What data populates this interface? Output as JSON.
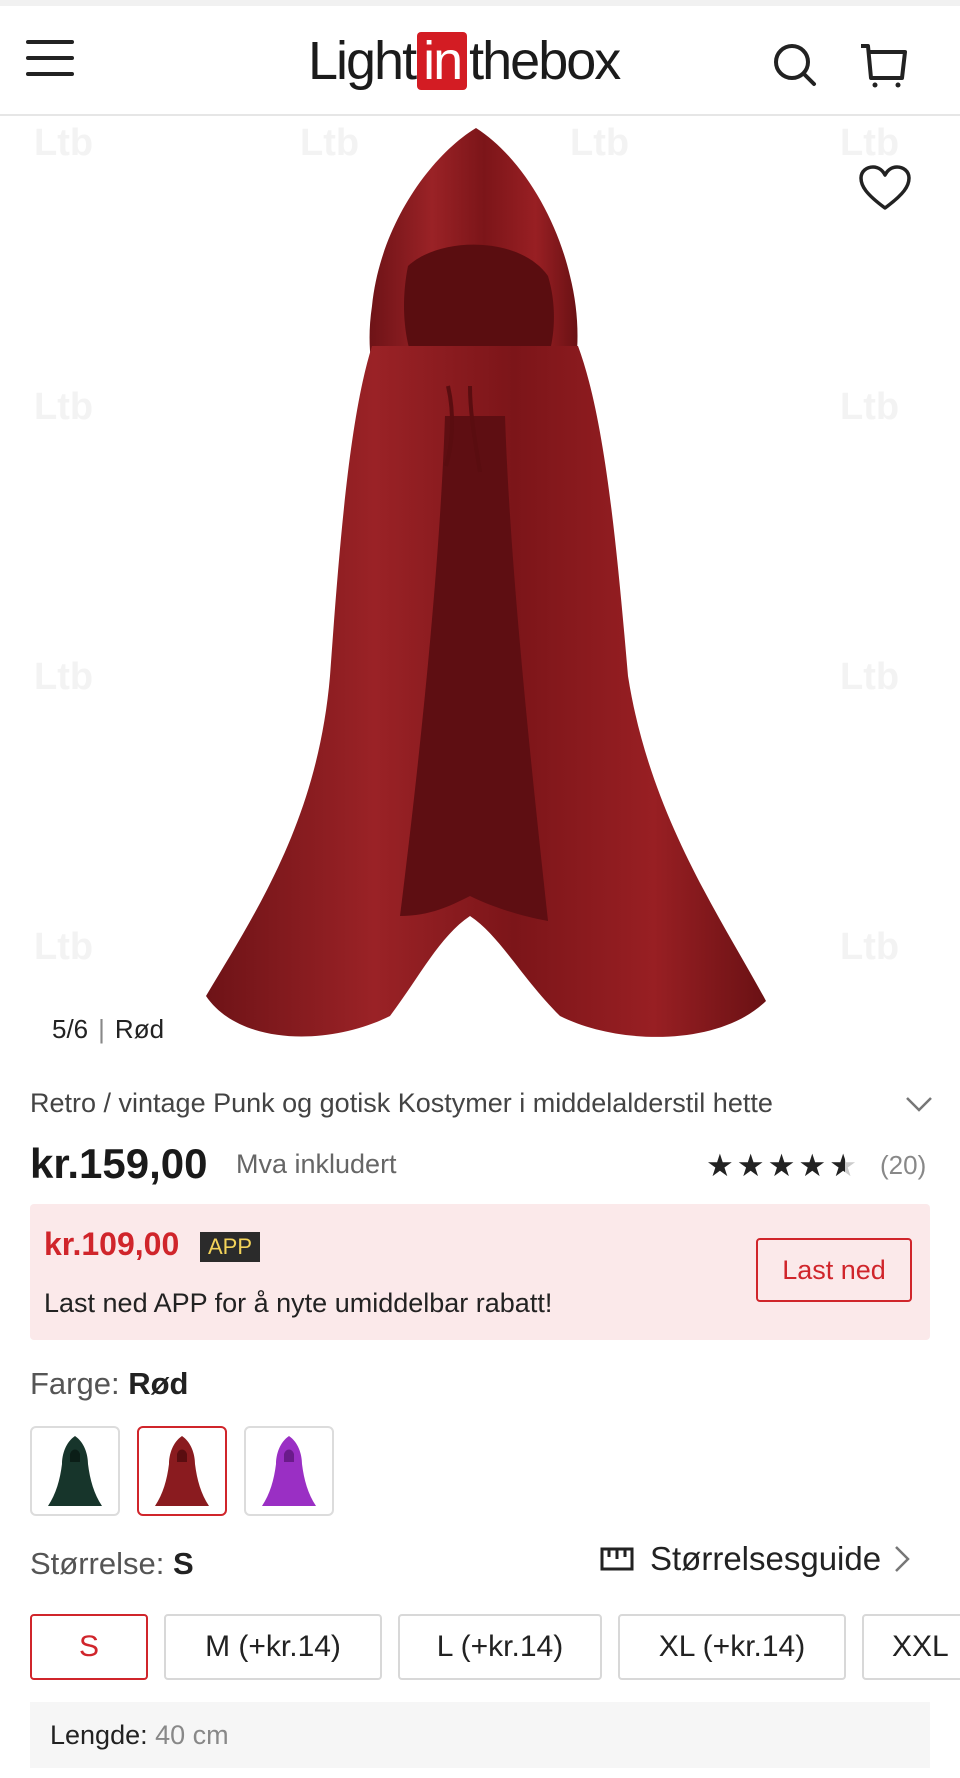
{
  "header": {
    "logo": {
      "part1": "Light",
      "part2": "in",
      "part3": "thebox"
    },
    "icons": {
      "menu": "hamburger-icon",
      "search": "search-icon",
      "cart": "cart-icon"
    }
  },
  "gallery": {
    "counter": "5/6",
    "color_name": "Rød",
    "wishlist_icon": "heart-icon",
    "watermark": "Ltb"
  },
  "product": {
    "title": "Retro / vintage Punk og gotisk Kostymer i middelalderstil hette",
    "price": "kr.159,00",
    "vat_note": "Mva inkludert",
    "rating": 4.5,
    "reviews_count": "(20)"
  },
  "app_promo": {
    "price": "kr.109,00",
    "badge": "APP",
    "text": "Last ned APP for å nyte umiddelbar rabatt!",
    "button": "Last ned"
  },
  "color": {
    "label": "Farge:",
    "selected": "Rød",
    "swatches": [
      {
        "name": "dark-green",
        "color": "#17352b"
      },
      {
        "name": "red",
        "color": "#8a1b1f"
      },
      {
        "name": "purple",
        "color": "#9a2fc4"
      }
    ]
  },
  "size": {
    "label": "Størrelse:",
    "selected": "S",
    "guide": "Størrelsesguide",
    "options": [
      "S",
      "M (+kr.14)",
      "L (+kr.14)",
      "XL (+kr.14)",
      "XXL"
    ]
  },
  "length": {
    "label": "Lengde:",
    "value": "40 cm"
  },
  "colors": {
    "accent": "#d0252b",
    "promo_bg": "#fbe9ea",
    "cloak": "#8a1b1f"
  }
}
